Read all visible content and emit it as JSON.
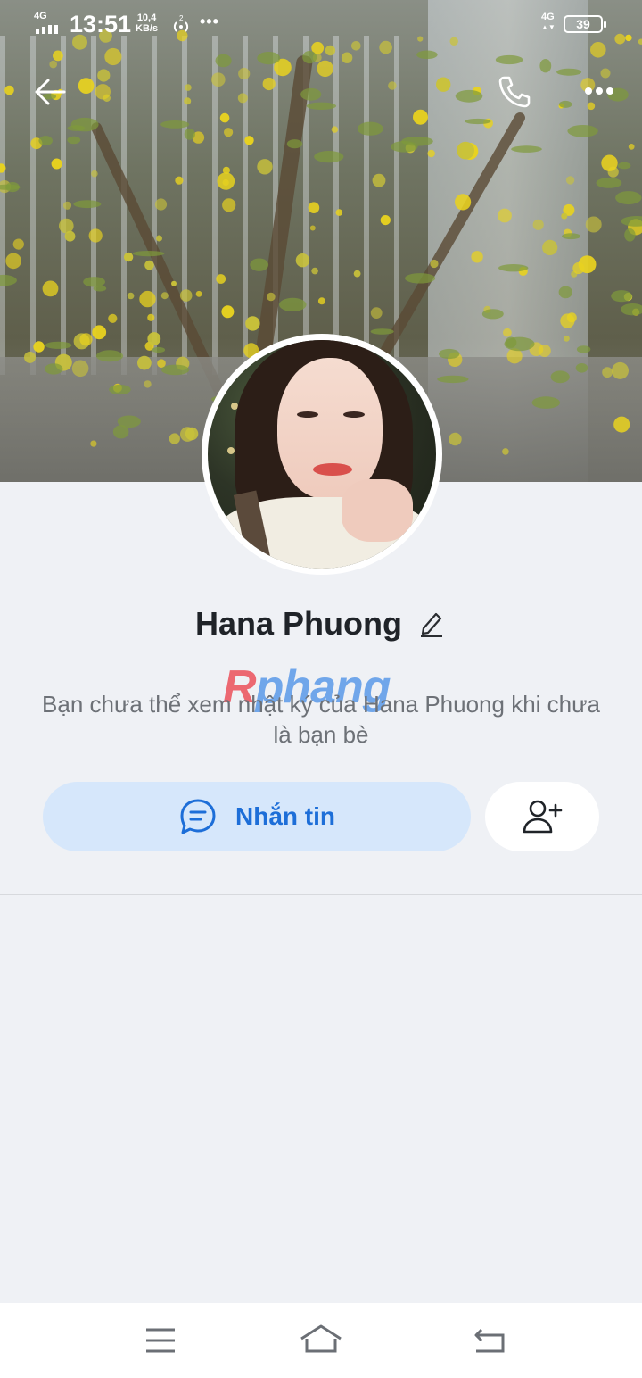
{
  "status_bar": {
    "network_left": "4G",
    "time": "13:51",
    "speed_value": "10,4",
    "speed_unit": "KB/s",
    "hotspot_count": "2",
    "more": "•••",
    "network_right": "4G",
    "battery": "39"
  },
  "profile": {
    "name": "Hana Phuong",
    "notice": "Bạn chưa thể xem nhật ký của Hana Phuong khi chưa là bạn bè"
  },
  "watermark": {
    "prefix": "R",
    "rest": "phang"
  },
  "actions": {
    "message_label": "Nhắn tin"
  },
  "colors": {
    "accent": "#1d6ed8",
    "message_button_bg": "#d6e7fb",
    "page_bg": "#eff1f5"
  },
  "icons": {
    "back": "arrow-left-icon",
    "call": "phone-icon",
    "more": "more-horizontal-icon",
    "edit": "pencil-icon",
    "message": "chat-bubble-icon",
    "add_friend": "user-plus-icon",
    "nav_menu": "menu-icon",
    "nav_home": "home-icon",
    "nav_back": "return-icon"
  }
}
